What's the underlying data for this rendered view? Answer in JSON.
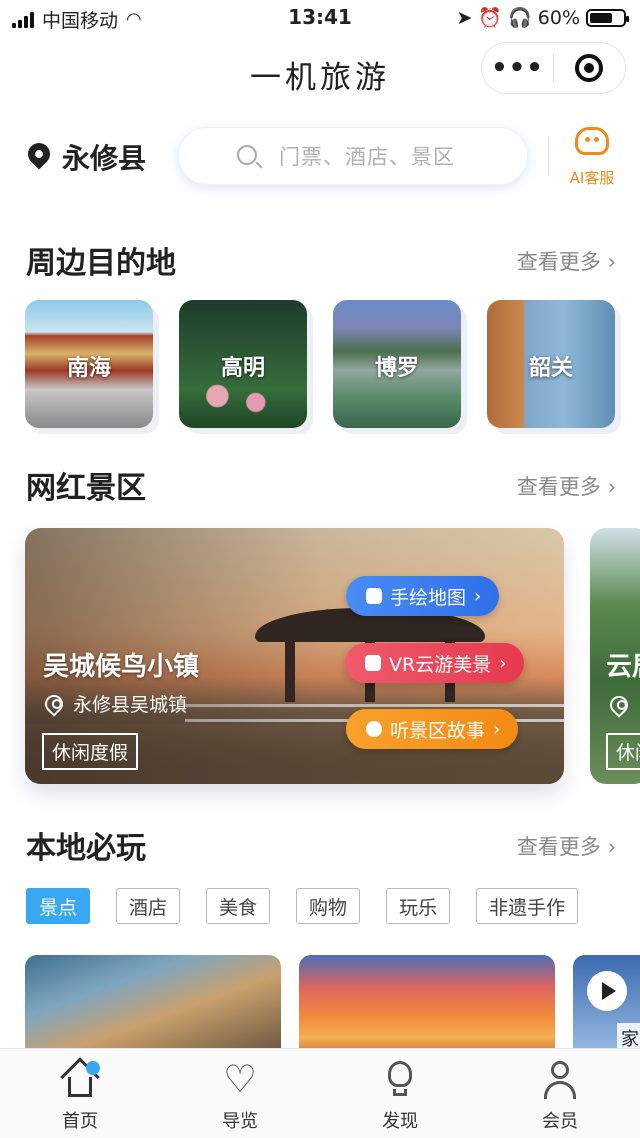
{
  "status_bar": {
    "carrier": "中国移动",
    "time": "13:41",
    "battery": "60%"
  },
  "nav": {
    "title": "一机旅游"
  },
  "location": {
    "city": "永修县"
  },
  "search": {
    "placeholder": "门票、酒店、景区"
  },
  "ai_service": {
    "label": "AI客服"
  },
  "colors": {
    "accent_blue": "#3aa8f0",
    "ai_orange": "#f08a1c"
  },
  "sections": {
    "nearby": {
      "title": "周边目的地",
      "more": "查看更多"
    },
    "popular": {
      "title": "网红景区",
      "more": "查看更多"
    },
    "local": {
      "title": "本地必玩",
      "more": "查看更多"
    }
  },
  "destinations": [
    {
      "name": "南海"
    },
    {
      "name": "高明"
    },
    {
      "name": "博罗"
    },
    {
      "name": "韶关"
    }
  ],
  "featured": [
    {
      "name": "吴城候鸟小镇",
      "location": "永修县吴城镇",
      "tag": "休闲度假",
      "actions": [
        "手绘地图",
        "VR云游美景",
        "听景区故事"
      ]
    },
    {
      "name": "云居",
      "tag": "休闲"
    }
  ],
  "categories": [
    "景点",
    "酒店",
    "美食",
    "购物",
    "玩乐",
    "非遗手作"
  ],
  "bottom_card": {
    "label": "家"
  },
  "tabbar": [
    "首页",
    "导览",
    "发现",
    "会员"
  ]
}
